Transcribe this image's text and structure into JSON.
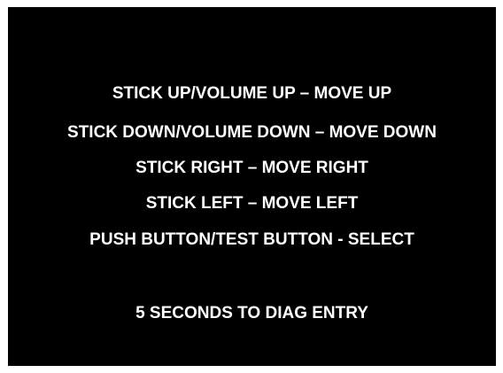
{
  "instructions": [
    "STICK UP/VOLUME UP – MOVE UP",
    "STICK DOWN/VOLUME DOWN – MOVE DOWN",
    "STICK RIGHT – MOVE RIGHT",
    "STICK LEFT – MOVE LEFT",
    "PUSH BUTTON/TEST BUTTON - SELECT"
  ],
  "countdown": "5 SECONDS TO DIAG ENTRY",
  "colors": {
    "background": "#000000",
    "text": "#ffffff",
    "frame": "#ffffff"
  }
}
